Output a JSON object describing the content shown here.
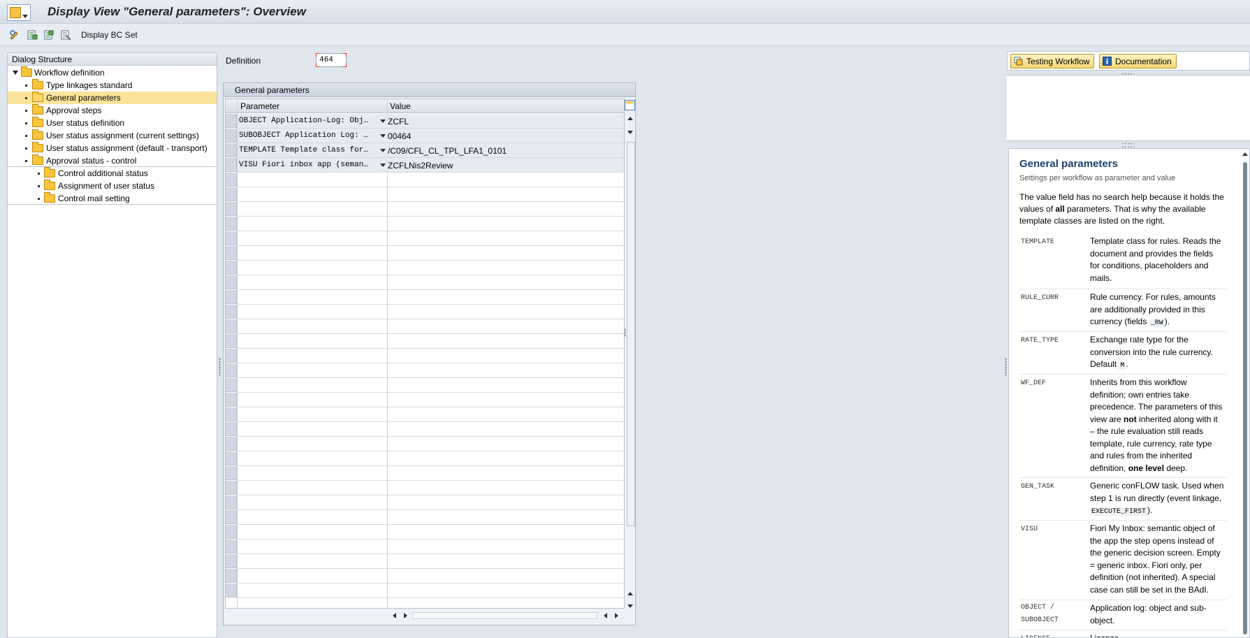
{
  "window": {
    "title": "Display View \"General parameters\": Overview"
  },
  "toolbar": {
    "display_bc_set_label": "Display BC Set"
  },
  "tree": {
    "header": "Dialog Structure",
    "items": [
      {
        "label": "Workflow definition",
        "level": 0,
        "expandable": true
      },
      {
        "label": "Type linkages standard",
        "level": 1
      },
      {
        "label": "General parameters",
        "level": 1,
        "selected": true
      },
      {
        "label": "Approval steps",
        "level": 1
      },
      {
        "label": "User status definition",
        "level": 1
      },
      {
        "label": "User status assignment (current settings)",
        "level": 1
      },
      {
        "label": "User status assignment (default - transport)",
        "level": 1
      },
      {
        "label": "Approval status - control",
        "level": 1,
        "expandable": true
      },
      {
        "label": "Control additional status",
        "level": 2
      },
      {
        "label": "Assignment of user status",
        "level": 2
      },
      {
        "label": "Control mail setting",
        "level": 2
      }
    ]
  },
  "definition": {
    "label": "Definition",
    "value": "464"
  },
  "table": {
    "title": "General parameters",
    "columns": {
      "parameter": "Parameter",
      "value": "Value"
    },
    "rows": [
      {
        "parameter": "OBJECT Application-Log: Obj…",
        "value": "ZCFL"
      },
      {
        "parameter": "SUBOBJECT Application Log: …",
        "value": "00464"
      },
      {
        "parameter": "TEMPLATE Template class for…",
        "value": "/C09/CFL_CL_TPL_LFA1_0101"
      },
      {
        "parameter": "VISU Fiori inbox app (seman…",
        "value": "ZCFLNis2Review"
      }
    ]
  },
  "right_panel": {
    "tabs": [
      {
        "label": "Testing Workflow",
        "icon": "test-workflow-icon"
      },
      {
        "label": "Documentation",
        "icon": "info-icon"
      }
    ]
  },
  "doc": {
    "title": "General parameters",
    "subtitle": "Settings per workflow as parameter and value",
    "intro": {
      "p1": "The value field has no search help because it holds the values of ",
      "bold": "all",
      "p2": " parameters. That is why the available template classes are listed on the right."
    },
    "entries": [
      {
        "key": "TEMPLATE",
        "desc": "Template class for rules. Reads the document and provides the fields for conditions, placeholders and mails."
      },
      {
        "key": "RULE_CURR",
        "desc_a": "Rule currency. For rules, amounts are additionally provided in this currency (fields ",
        "code": "_RW",
        "desc_b": ")."
      },
      {
        "key": "RATE_TYPE",
        "desc_a": "Exchange rate type for the conversion into the rule currency. Default ",
        "code": "M",
        "desc_b": "."
      },
      {
        "key": "WF_DEF",
        "desc_a": "Inherits from this workflow definition; own entries take precedence. The parameters of this view are ",
        "bold1": "not",
        "desc_b": " inherited along with it – the rule evaluation still reads template, rule currency, rate type and rules from the inherited definition, ",
        "bold2": "one level",
        "desc_c": " deep."
      },
      {
        "key": "GEN_TASK",
        "desc_a": "Generic conFLOW task. Used when step 1 is run directly (event linkage, ",
        "code": "EXECUTE_FIRST",
        "desc_b": ")."
      },
      {
        "key": "VISU",
        "desc": "Fiori My Inbox: semantic object of the app the step opens instead of the generic decision screen. Empty = generic inbox. Fiori only, per definition (not inherited). A special case can still be set in the BAdI."
      },
      {
        "key": "OBJECT / SUBOBJECT",
        "desc": "Application log: object and sub-object."
      },
      {
        "key": "LICENSE",
        "desc": "Licence"
      }
    ]
  }
}
